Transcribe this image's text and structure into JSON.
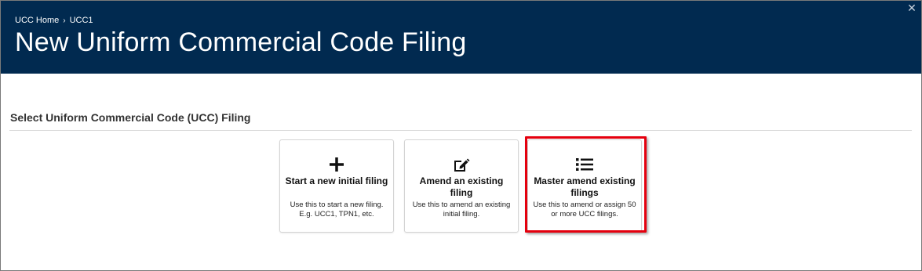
{
  "header": {
    "breadcrumb": [
      "UCC Home",
      "UCC1"
    ],
    "breadcrumb_separator": "›",
    "title": "New Uniform Commercial Code Filing",
    "close_icon": "close-icon"
  },
  "colors": {
    "header_bg": "#012a50",
    "highlight": "#e5000e"
  },
  "section": {
    "title": "Select Uniform Commercial Code (UCC) Filing"
  },
  "cards": [
    {
      "icon": "plus-icon",
      "title": "Start a new initial filing",
      "description": "Use this to start a new filing. E.g. UCC1, TPN1, etc."
    },
    {
      "icon": "edit-icon",
      "title": "Amend an existing filing",
      "description": "Use this to amend an existing initial filing."
    },
    {
      "icon": "list-icon",
      "title": "Master amend existing filings",
      "description": "Use this to amend or assign 50 or more UCC filings."
    }
  ]
}
